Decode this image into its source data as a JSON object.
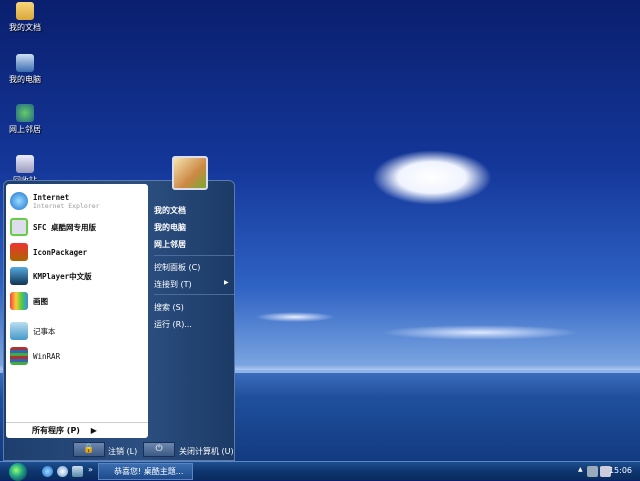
{
  "desktop": {
    "icons": [
      {
        "label": "我的文档",
        "icon": "folder-icon"
      },
      {
        "label": "我的电脑",
        "icon": "computer-icon"
      },
      {
        "label": "网上邻居",
        "icon": "network-icon"
      },
      {
        "label": "回收站",
        "icon": "recycle-bin-icon"
      }
    ]
  },
  "start_menu": {
    "pinned": [
      {
        "label": "Internet",
        "sub": "Internet Explorer",
        "icon": "ie-icon"
      },
      {
        "label": "SFC 桌酷网专用版",
        "icon": "sfc-icon"
      },
      {
        "label": "IconPackager",
        "icon": "iconpackager-icon"
      },
      {
        "label": "KMPlayer中文版",
        "icon": "kmplayer-icon"
      },
      {
        "label": "画图",
        "icon": "paint-icon"
      },
      {
        "label": "记事本",
        "icon": "notepad-icon"
      },
      {
        "label": "WinRAR",
        "icon": "winrar-icon"
      }
    ],
    "all_programs": "所有程序 (P)",
    "right": [
      "我的文档",
      "我的电脑",
      "网上邻居",
      "控制面板 (C)",
      "连接到 (T)",
      "搜索 (S)",
      "运行 (R)..."
    ],
    "logoff": "注销 (L)",
    "shutdown": "关闭计算机 (U)"
  },
  "taskbar": {
    "task": "恭喜您! 桌酷主题...",
    "clock": "15:06",
    "overflow": "»"
  }
}
